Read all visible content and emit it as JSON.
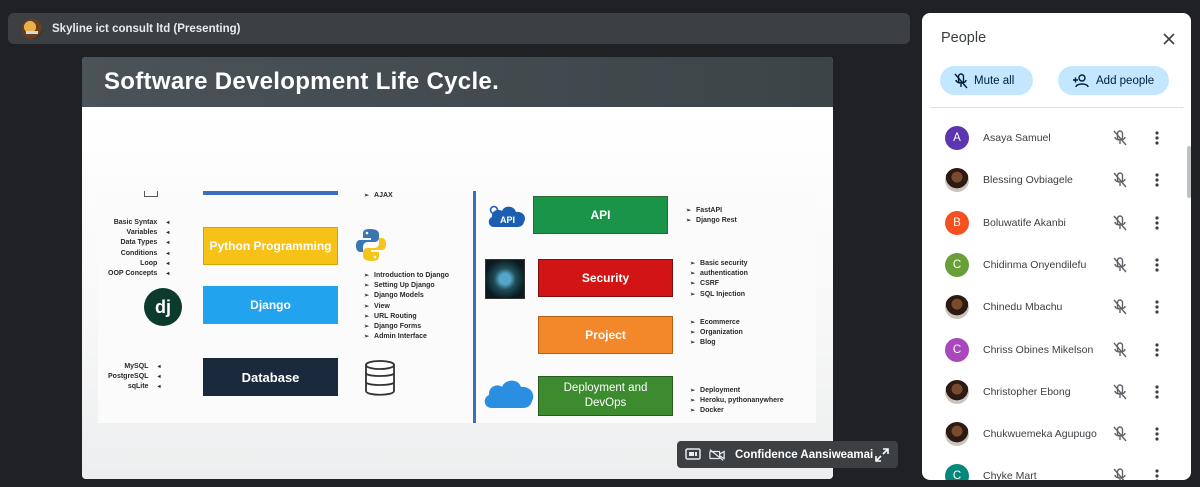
{
  "topbar": {
    "title": "Skyline ict consult ltd (Presenting)"
  },
  "slide": {
    "title": "Software Development Life Cycle.",
    "boxes": {
      "python": "Python Programming",
      "django": "Django",
      "database": "Database",
      "api": "API",
      "security": "Security",
      "project": "Project",
      "deploy": "Deployment and DevOps"
    },
    "lists": {
      "basic": [
        "Basic Syntax",
        "Variables",
        "Data Types",
        "Conditions",
        "Loop",
        "OOP Concepts"
      ],
      "db": [
        "MySQL",
        "PostgreSQL",
        "sqLite"
      ],
      "ajax": [
        "AJAX"
      ],
      "django": [
        "Introduction to Django",
        "Setting Up Django",
        "Django Models",
        "View",
        "URL Routing",
        "Django Forms",
        "Admin Interface"
      ],
      "api": [
        "FastAPI",
        "Django Rest"
      ],
      "security": [
        "Basic security",
        "authentication",
        "CSRF",
        "SQL Injection"
      ],
      "project": [
        "Ecommerce",
        "Organization",
        "Blog"
      ],
      "deploy": [
        "Deployment",
        "Heroku, pythonanywhere",
        "Docker"
      ]
    },
    "logos": {
      "django": "dj",
      "api": "API"
    }
  },
  "caption": {
    "name": "Confidence Aansiweamai"
  },
  "people": {
    "title": "People",
    "mute_all": "Mute all",
    "add_people": "Add people",
    "participants": [
      {
        "name": "Asaya Samuel",
        "initial": "A",
        "color": "#5e35b1",
        "photo": false
      },
      {
        "name": "Blessing Ovbiagele",
        "initial": "",
        "color": "#9e9e9e",
        "photo": true
      },
      {
        "name": "Boluwatife Akanbi",
        "initial": "B",
        "color": "#f4511e",
        "photo": false
      },
      {
        "name": "Chidinma Onyendilefu",
        "initial": "C",
        "color": "#689f38",
        "photo": false
      },
      {
        "name": "Chinedu Mbachu",
        "initial": "",
        "color": "#795548",
        "photo": true
      },
      {
        "name": "Chriss Obines Mikelson",
        "initial": "C",
        "color": "#ab47bc",
        "photo": false
      },
      {
        "name": "Christopher Ebong",
        "initial": "",
        "color": "#37474f",
        "photo": true
      },
      {
        "name": "Chukwuemeka Agupugo",
        "initial": "",
        "color": "#6d4c41",
        "photo": true
      },
      {
        "name": "Chyke Mart",
        "initial": "C",
        "color": "#00897b",
        "photo": false
      }
    ]
  }
}
